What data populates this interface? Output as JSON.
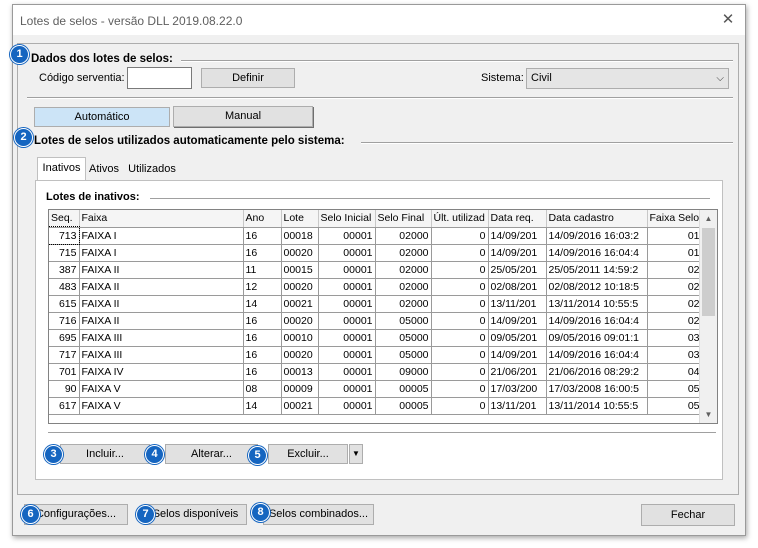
{
  "window": {
    "title": "Lotes de selos - versão DLL 2019.08.22.0"
  },
  "section1": {
    "badge": "1",
    "title": "Dados dos lotes de selos:",
    "codigo_label": "Código serventia:",
    "codigo_value": "",
    "definir_label": "Definir",
    "sistema_label": "Sistema:",
    "sistema_value": "Civil"
  },
  "mode_buttons": {
    "automatico": "Automático",
    "manual": "Manual"
  },
  "section2": {
    "badge": "2",
    "title": "Lotes de selos utilizados automaticamente pelo sistema:"
  },
  "tabs": [
    "Inativos",
    "Ativos",
    "Utilizados"
  ],
  "grid": {
    "title": "Lotes de inativos:",
    "columns": [
      "Seq.",
      "Faixa",
      "Ano",
      "Lote",
      "Selo Inicial",
      "Selo Final",
      "Últ. utilizad",
      "Data req.",
      "Data cadastro",
      "Faixa Selo"
    ],
    "rows": [
      [
        "713",
        "FAIXA I",
        "16",
        "00018",
        "00001",
        "02000",
        "0",
        "14/09/201",
        "14/09/2016 16:03:2",
        "01"
      ],
      [
        "715",
        "FAIXA I",
        "16",
        "00020",
        "00001",
        "02000",
        "0",
        "14/09/201",
        "14/09/2016 16:04:4",
        "01"
      ],
      [
        "387",
        "FAIXA II",
        "11",
        "00015",
        "00001",
        "02000",
        "0",
        "25/05/201",
        "25/05/2011 14:59:2",
        "02"
      ],
      [
        "483",
        "FAIXA II",
        "12",
        "00020",
        "00001",
        "02000",
        "0",
        "02/08/201",
        "02/08/2012 10:18:5",
        "02"
      ],
      [
        "615",
        "FAIXA II",
        "14",
        "00021",
        "00001",
        "02000",
        "0",
        "13/11/201",
        "13/11/2014 10:55:5",
        "02"
      ],
      [
        "716",
        "FAIXA II",
        "16",
        "00020",
        "00001",
        "05000",
        "0",
        "14/09/201",
        "14/09/2016 16:04:4",
        "02"
      ],
      [
        "695",
        "FAIXA III",
        "16",
        "00010",
        "00001",
        "05000",
        "0",
        "09/05/201",
        "09/05/2016 09:01:1",
        "03"
      ],
      [
        "717",
        "FAIXA III",
        "16",
        "00020",
        "00001",
        "05000",
        "0",
        "14/09/201",
        "14/09/2016 16:04:4",
        "03"
      ],
      [
        "701",
        "FAIXA IV",
        "16",
        "00013",
        "00001",
        "09000",
        "0",
        "21/06/201",
        "21/06/2016 08:29:2",
        "04"
      ],
      [
        "90",
        "FAIXA V",
        "08",
        "00009",
        "00001",
        "00005",
        "0",
        "17/03/200",
        "17/03/2008 16:00:5",
        "05"
      ],
      [
        "617",
        "FAIXA V",
        "14",
        "00021",
        "00001",
        "00005",
        "0",
        "13/11/201",
        "13/11/2014 10:55:5",
        "05"
      ]
    ]
  },
  "actions": {
    "incluir": {
      "badge": "3",
      "label": "Incluir..."
    },
    "alterar": {
      "badge": "4",
      "label": "Alterar..."
    },
    "excluir": {
      "badge": "5",
      "label": "Excluir..."
    }
  },
  "footer": {
    "configuracoes": {
      "badge": "6",
      "label": "Configurações..."
    },
    "selos_disponiveis": {
      "badge": "7",
      "label": "Selos disponíveis"
    },
    "selos_combinados": {
      "badge": "8",
      "label": "Selos combinados..."
    },
    "fechar": "Fechar"
  },
  "colors": {
    "badge": "#1565c0",
    "window_bg": "#f0f0f0"
  }
}
